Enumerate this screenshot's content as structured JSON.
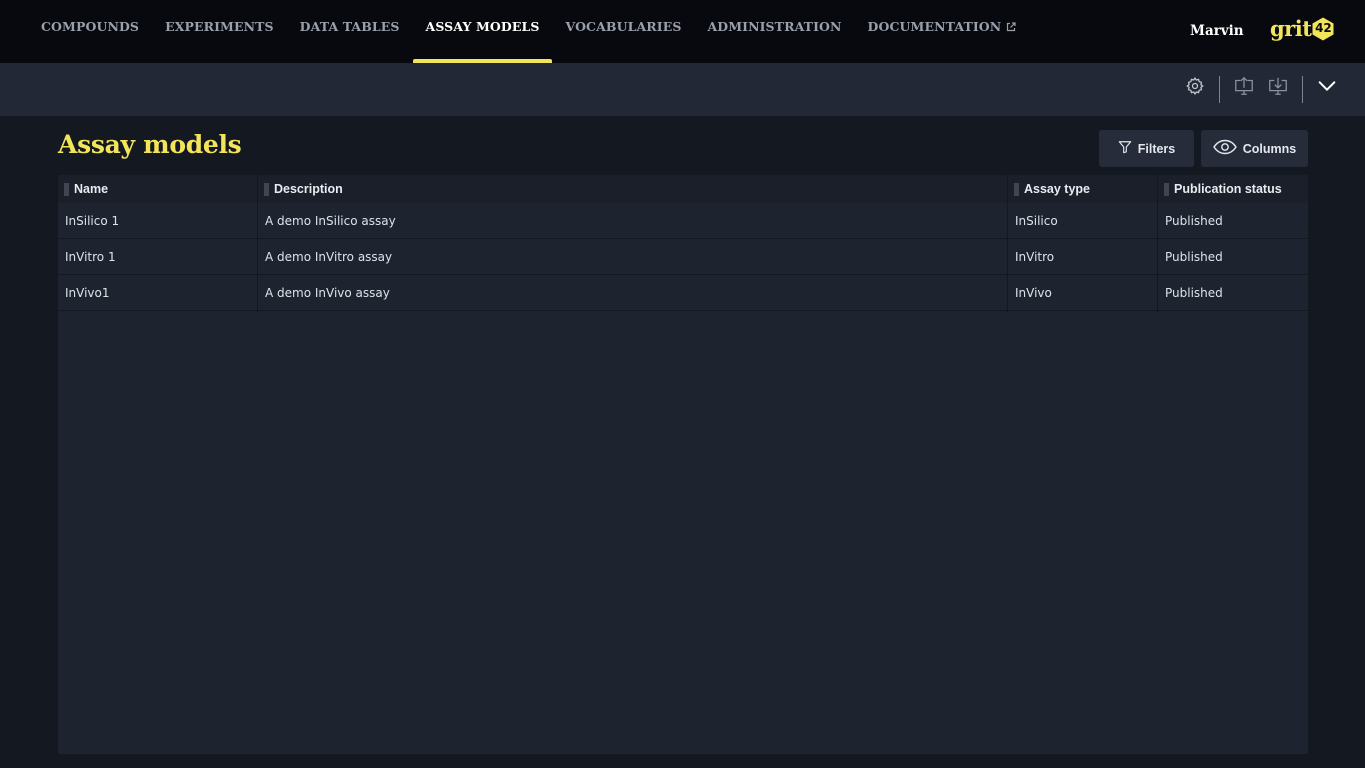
{
  "nav": {
    "items": [
      {
        "label": "COMPOUNDS",
        "active": false
      },
      {
        "label": "EXPERIMENTS",
        "active": false
      },
      {
        "label": "DATA TABLES",
        "active": false
      },
      {
        "label": "ASSAY MODELS",
        "active": true
      },
      {
        "label": "VOCABULARIES",
        "active": false
      },
      {
        "label": "ADMINISTRATION",
        "active": false
      },
      {
        "label": "DOCUMENTATION",
        "active": false,
        "external": true
      }
    ],
    "user": "Marvin",
    "logo_text": "grit",
    "logo_badge": "42"
  },
  "toolbar": {
    "icons": [
      "gear-icon",
      "upload-icon",
      "download-icon",
      "chevron-down-icon"
    ]
  },
  "page": {
    "title": "Assay models",
    "filters_label": "Filters",
    "columns_label": "Columns"
  },
  "table": {
    "columns": [
      "Name",
      "Description",
      "Assay type",
      "Publication status"
    ],
    "rows": [
      [
        "InSilico 1",
        "A demo InSilico assay",
        "InSilico",
        "Published"
      ],
      [
        "InVitro 1",
        "A demo InVitro assay",
        "InVitro",
        "Published"
      ],
      [
        "InVivo1",
        "A demo InVivo assay",
        "InVivo",
        "Published"
      ]
    ]
  },
  "colors": {
    "accent": "#f3e55a",
    "nav_bg": "#07090e",
    "toolbar_bg": "#222836",
    "page_bg": "#141821",
    "grid_bg": "#1e2330"
  }
}
